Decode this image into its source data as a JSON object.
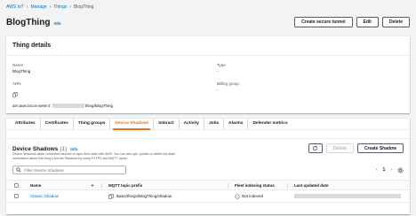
{
  "breadcrumb": {
    "items": [
      "AWS IoT",
      "Manage",
      "Things"
    ],
    "current": "BlogThing"
  },
  "header": {
    "title": "BlogThing",
    "info": "Info",
    "actions": {
      "tunnel": "Create secure tunnel",
      "edit": "Edit",
      "delete": "Delete"
    }
  },
  "details": {
    "title": "Thing details",
    "name_label": "Name",
    "name_value": "BlogThing",
    "arn_label": "ARN",
    "arn_prefix": "arn:aws:iot:us-west-2:",
    "arn_suffix": "thing/BlogThing",
    "type_label": "Type",
    "type_value": "-",
    "billing_label": "Billing group",
    "billing_value": "-"
  },
  "tabs": [
    "Attributes",
    "Certificates",
    "Thing groups",
    "Device Shadows",
    "Interact",
    "Activity",
    "Jobs",
    "Alarms",
    "Defender metrics"
  ],
  "active_tab": "Device Shadows",
  "shadows": {
    "title": "Device Shadows",
    "count": "(1)",
    "info": "Info",
    "desc": "Device Shadows allow connected devices to sync their state with AWS. You can also get, update or delete the state information about this thing's Device Shadows by using HTTPS and MQTT topics.",
    "delete": "Delete",
    "create": "Create Shadow",
    "search_placeholder": "Filter Device Shadows",
    "page": "1",
    "columns": {
      "name": "Name",
      "mqtt": "MQTT topic prefix",
      "fleet": "Fleet indexing status",
      "updated": "Last updated date"
    },
    "rows": [
      {
        "name": "Classic Shadow",
        "mqtt": "$aws/things/BlogThing/shadow",
        "fleet": "Not indexed"
      }
    ]
  },
  "colors": {
    "accent": "#ec7211",
    "link": "#0073bb"
  }
}
